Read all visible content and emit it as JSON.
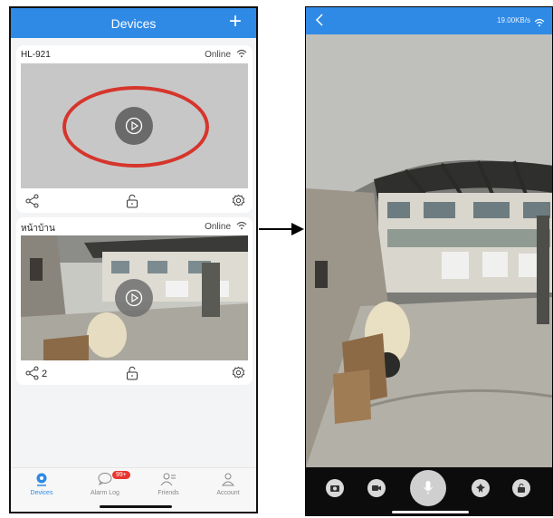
{
  "left_phone": {
    "header": {
      "title": "Devices",
      "add_icon": "plus-icon"
    },
    "devices": [
      {
        "name": "HL-921",
        "status": "Online",
        "share_count": ""
      },
      {
        "name": "หน้าบ้าน",
        "status": "Online",
        "share_count": "2"
      }
    ],
    "tabbar": {
      "tabs": [
        {
          "label": "Devices",
          "icon": "camera-icon",
          "active": true
        },
        {
          "label": "Alarm Log",
          "icon": "chat-bubble-icon",
          "badge": "99+"
        },
        {
          "label": "Friends",
          "icon": "friends-icon"
        },
        {
          "label": "Account",
          "icon": "person-icon"
        }
      ]
    }
  },
  "right_phone": {
    "header": {
      "speed": "19.00KB/s"
    },
    "controls": [
      "camera-snapshot-icon",
      "video-record-icon",
      "microphone-icon",
      "pin-icon",
      "lock-icon"
    ]
  },
  "colors": {
    "accent": "#2f8ae6",
    "highlight": "#d6352c",
    "badge": "#e8352e"
  }
}
